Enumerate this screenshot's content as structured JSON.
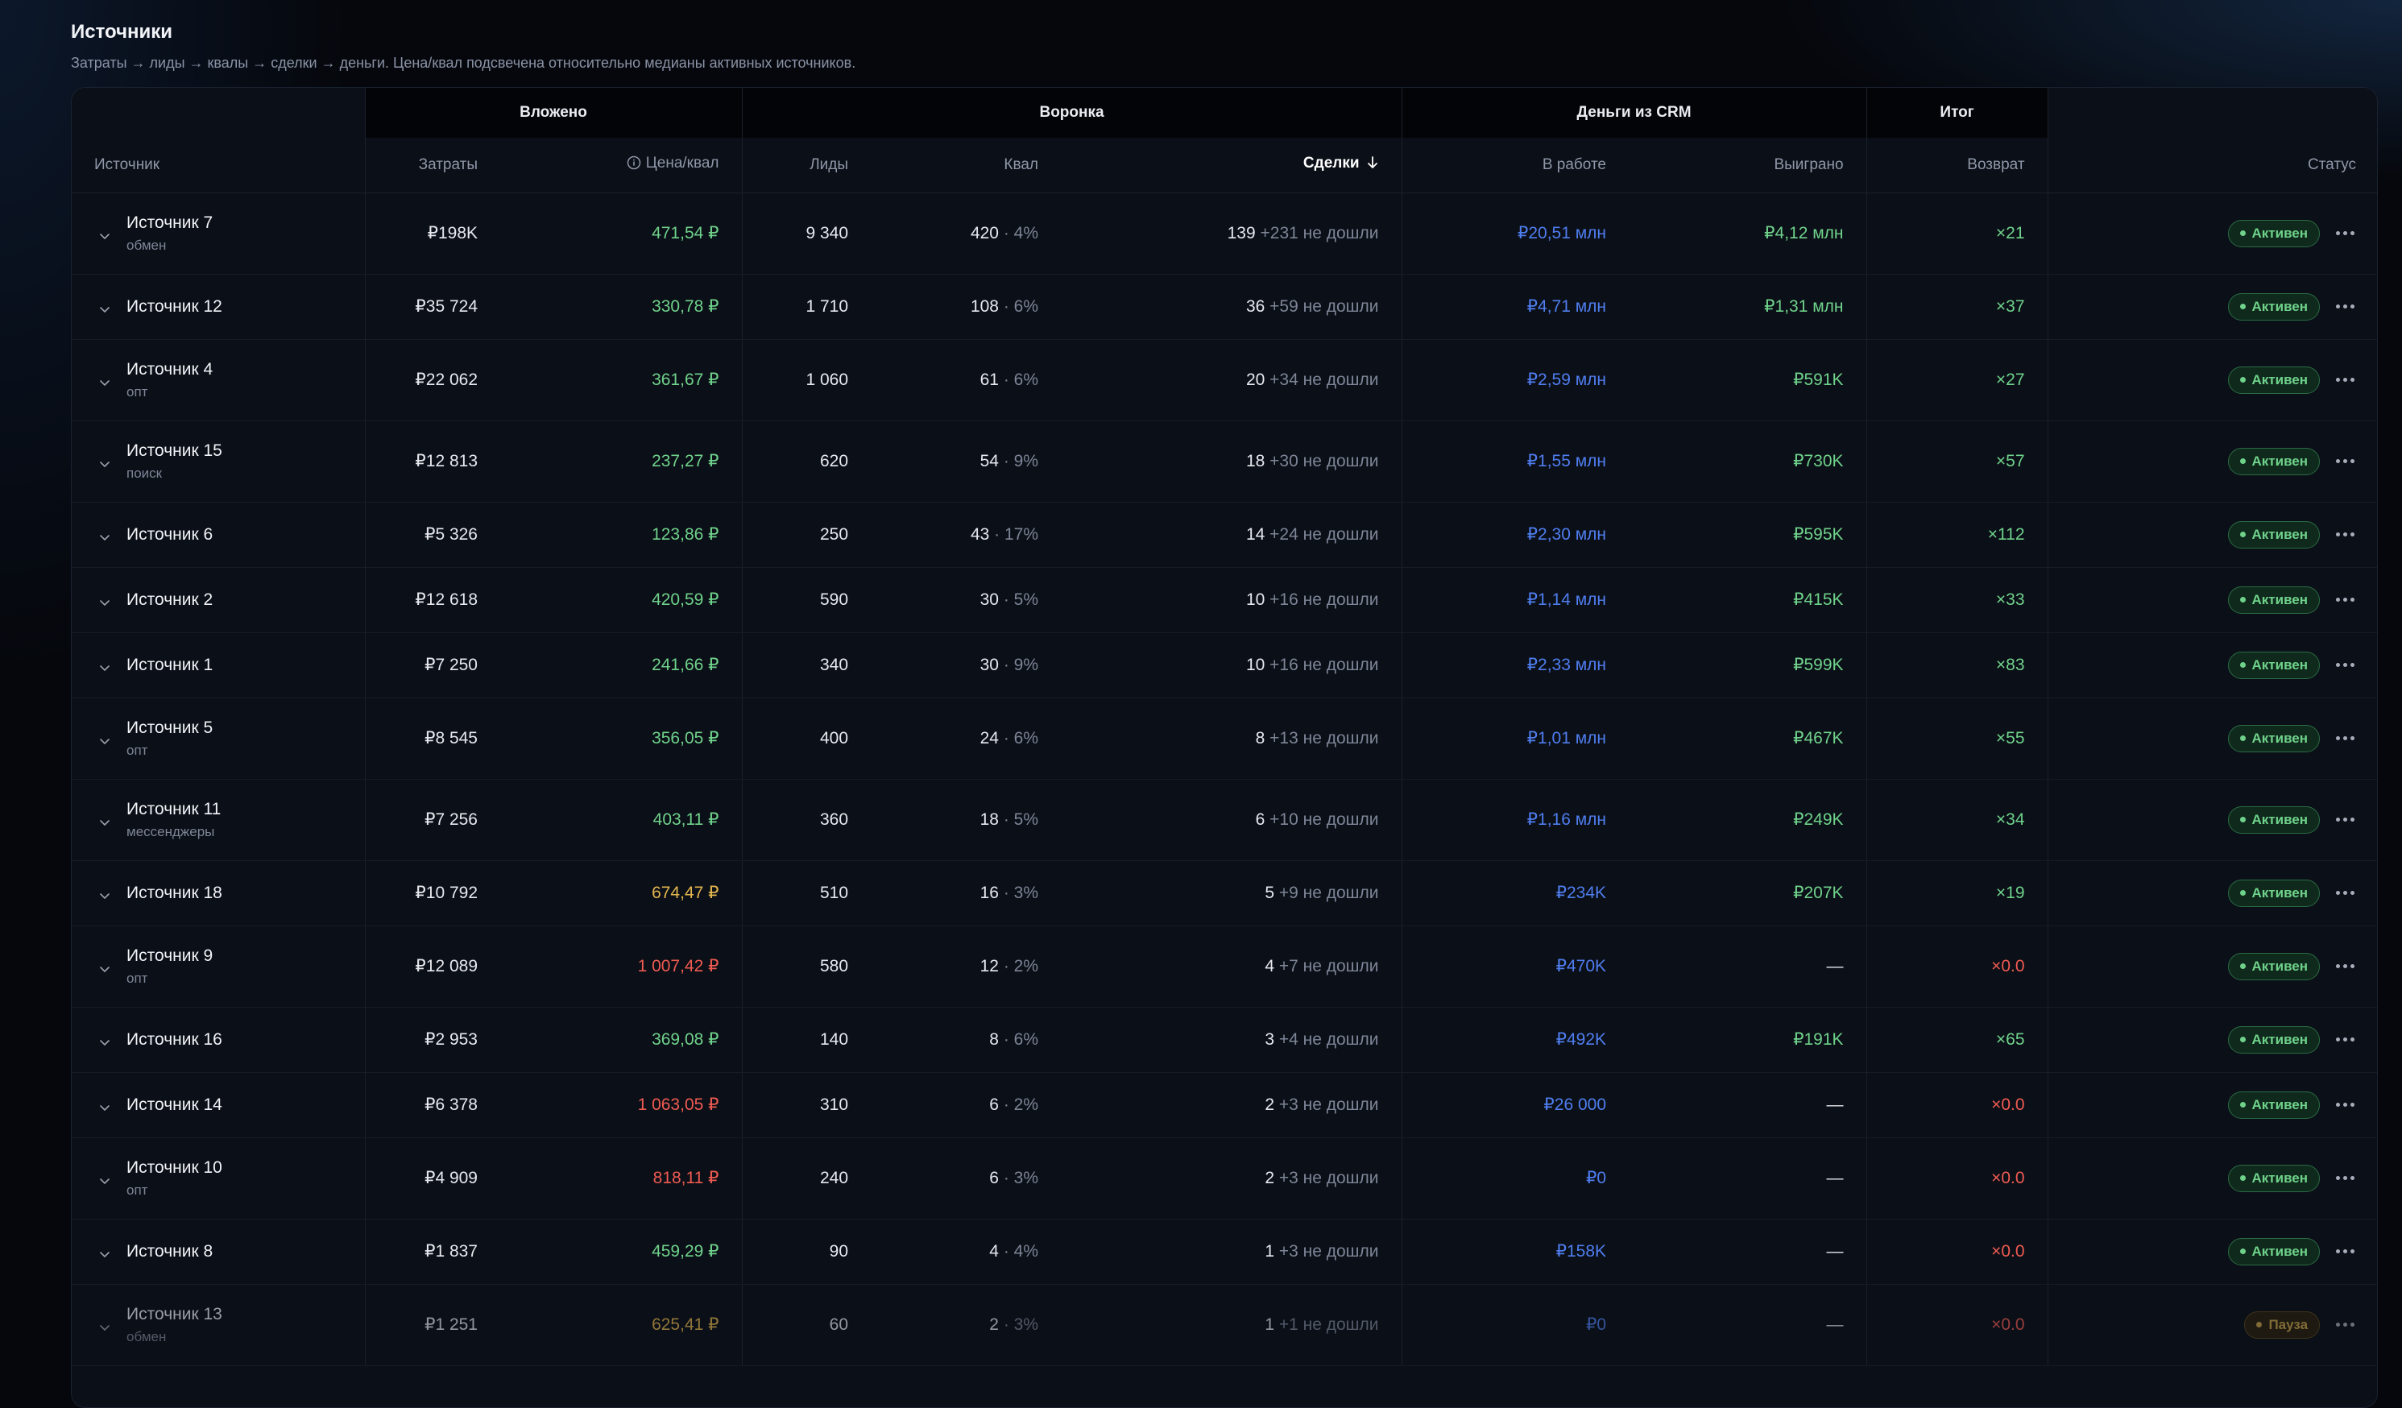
{
  "page": {
    "title": "Источники",
    "subtitle": "Затраты → лиды → квалы → сделки → деньги. Цена/квал подсвечена относительно медианы активных источников."
  },
  "colors": {
    "accent_blue": "#4f7ef0",
    "good_green": "#6fd28b",
    "warn_yellow": "#e2b54e",
    "bad_red": "#ef5b52"
  },
  "table": {
    "groups": {
      "invested": "Вложено",
      "funnel": "Воронка",
      "crm": "Деньги из CRM",
      "total": "Итог"
    },
    "columns": {
      "source": "Источник",
      "cost": "Затраты",
      "cpq": "Цена/квал",
      "leads": "Лиды",
      "qual": "Квал",
      "deals": "Сделки",
      "in_work": "В работе",
      "won": "Выиграно",
      "return": "Возврат",
      "status": "Статус"
    },
    "sort": {
      "column": "deals",
      "direction": "desc",
      "icon": "arrow-down-icon"
    },
    "rows": [
      {
        "name": "Источник 7",
        "sub": "обмен",
        "cost": "₽198K",
        "cpq": "471,54 ₽",
        "cpq_level": "green",
        "leads": "9 340",
        "qual": "420",
        "qual_pct": "4%",
        "deals": "139",
        "deals_lost": "+231 не дошли",
        "in_work": "₽20,51 млн",
        "won": "₽4,12 млн",
        "won_dash": false,
        "ret": "×21",
        "ret_level": "green",
        "status": "Активен",
        "status_type": "active"
      },
      {
        "name": "Источник 12",
        "sub": "",
        "cost": "₽35 724",
        "cpq": "330,78 ₽",
        "cpq_level": "green",
        "leads": "1 710",
        "qual": "108",
        "qual_pct": "6%",
        "deals": "36",
        "deals_lost": "+59 не дошли",
        "in_work": "₽4,71 млн",
        "won": "₽1,31 млн",
        "won_dash": false,
        "ret": "×37",
        "ret_level": "green",
        "status": "Активен",
        "status_type": "active"
      },
      {
        "name": "Источник 4",
        "sub": "опт",
        "cost": "₽22 062",
        "cpq": "361,67 ₽",
        "cpq_level": "green",
        "leads": "1 060",
        "qual": "61",
        "qual_pct": "6%",
        "deals": "20",
        "deals_lost": "+34 не дошли",
        "in_work": "₽2,59 млн",
        "won": "₽591K",
        "won_dash": false,
        "ret": "×27",
        "ret_level": "green",
        "status": "Активен",
        "status_type": "active"
      },
      {
        "name": "Источник 15",
        "sub": "поиск",
        "cost": "₽12 813",
        "cpq": "237,27 ₽",
        "cpq_level": "green",
        "leads": "620",
        "qual": "54",
        "qual_pct": "9%",
        "deals": "18",
        "deals_lost": "+30 не дошли",
        "in_work": "₽1,55 млн",
        "won": "₽730K",
        "won_dash": false,
        "ret": "×57",
        "ret_level": "green",
        "status": "Активен",
        "status_type": "active"
      },
      {
        "name": "Источник 6",
        "sub": "",
        "cost": "₽5 326",
        "cpq": "123,86 ₽",
        "cpq_level": "green",
        "leads": "250",
        "qual": "43",
        "qual_pct": "17%",
        "deals": "14",
        "deals_lost": "+24 не дошли",
        "in_work": "₽2,30 млн",
        "won": "₽595K",
        "won_dash": false,
        "ret": "×112",
        "ret_level": "green",
        "status": "Активен",
        "status_type": "active"
      },
      {
        "name": "Источник 2",
        "sub": "",
        "cost": "₽12 618",
        "cpq": "420,59 ₽",
        "cpq_level": "green",
        "leads": "590",
        "qual": "30",
        "qual_pct": "5%",
        "deals": "10",
        "deals_lost": "+16 не дошли",
        "in_work": "₽1,14 млн",
        "won": "₽415K",
        "won_dash": false,
        "ret": "×33",
        "ret_level": "green",
        "status": "Активен",
        "status_type": "active"
      },
      {
        "name": "Источник 1",
        "sub": "",
        "cost": "₽7 250",
        "cpq": "241,66 ₽",
        "cpq_level": "green",
        "leads": "340",
        "qual": "30",
        "qual_pct": "9%",
        "deals": "10",
        "deals_lost": "+16 не дошли",
        "in_work": "₽2,33 млн",
        "won": "₽599K",
        "won_dash": false,
        "ret": "×83",
        "ret_level": "green",
        "status": "Активен",
        "status_type": "active"
      },
      {
        "name": "Источник 5",
        "sub": "опт",
        "cost": "₽8 545",
        "cpq": "356,05 ₽",
        "cpq_level": "green",
        "leads": "400",
        "qual": "24",
        "qual_pct": "6%",
        "deals": "8",
        "deals_lost": "+13 не дошли",
        "in_work": "₽1,01 млн",
        "won": "₽467K",
        "won_dash": false,
        "ret": "×55",
        "ret_level": "green",
        "status": "Активен",
        "status_type": "active"
      },
      {
        "name": "Источник 11",
        "sub": "мессенджеры",
        "cost": "₽7 256",
        "cpq": "403,11 ₽",
        "cpq_level": "green",
        "leads": "360",
        "qual": "18",
        "qual_pct": "5%",
        "deals": "6",
        "deals_lost": "+10 не дошли",
        "in_work": "₽1,16 млн",
        "won": "₽249K",
        "won_dash": false,
        "ret": "×34",
        "ret_level": "green",
        "status": "Активен",
        "status_type": "active"
      },
      {
        "name": "Источник 18",
        "sub": "",
        "cost": "₽10 792",
        "cpq": "674,47 ₽",
        "cpq_level": "yellow",
        "leads": "510",
        "qual": "16",
        "qual_pct": "3%",
        "deals": "5",
        "deals_lost": "+9 не дошли",
        "in_work": "₽234K",
        "won": "₽207K",
        "won_dash": false,
        "ret": "×19",
        "ret_level": "green",
        "status": "Активен",
        "status_type": "active"
      },
      {
        "name": "Источник 9",
        "sub": "опт",
        "cost": "₽12 089",
        "cpq": "1 007,42 ₽",
        "cpq_level": "red",
        "leads": "580",
        "qual": "12",
        "qual_pct": "2%",
        "deals": "4",
        "deals_lost": "+7 не дошли",
        "in_work": "₽470K",
        "won": "—",
        "won_dash": true,
        "ret": "×0.0",
        "ret_level": "red",
        "status": "Активен",
        "status_type": "active"
      },
      {
        "name": "Источник 16",
        "sub": "",
        "cost": "₽2 953",
        "cpq": "369,08 ₽",
        "cpq_level": "green",
        "leads": "140",
        "qual": "8",
        "qual_pct": "6%",
        "deals": "3",
        "deals_lost": "+4 не дошли",
        "in_work": "₽492K",
        "won": "₽191K",
        "won_dash": false,
        "ret": "×65",
        "ret_level": "green",
        "status": "Активен",
        "status_type": "active"
      },
      {
        "name": "Источник 14",
        "sub": "",
        "cost": "₽6 378",
        "cpq": "1 063,05 ₽",
        "cpq_level": "red",
        "leads": "310",
        "qual": "6",
        "qual_pct": "2%",
        "deals": "2",
        "deals_lost": "+3 не дошли",
        "in_work": "₽26 000",
        "won": "—",
        "won_dash": true,
        "ret": "×0.0",
        "ret_level": "red",
        "status": "Активен",
        "status_type": "active"
      },
      {
        "name": "Источник 10",
        "sub": "опт",
        "cost": "₽4 909",
        "cpq": "818,11 ₽",
        "cpq_level": "red",
        "leads": "240",
        "qual": "6",
        "qual_pct": "3%",
        "deals": "2",
        "deals_lost": "+3 не дошли",
        "in_work": "₽0",
        "won": "—",
        "won_dash": true,
        "ret": "×0.0",
        "ret_level": "red",
        "status": "Активен",
        "status_type": "active"
      },
      {
        "name": "Источник 8",
        "sub": "",
        "cost": "₽1 837",
        "cpq": "459,29 ₽",
        "cpq_level": "green",
        "leads": "90",
        "qual": "4",
        "qual_pct": "4%",
        "deals": "1",
        "deals_lost": "+3 не дошли",
        "in_work": "₽158K",
        "won": "—",
        "won_dash": true,
        "ret": "×0.0",
        "ret_level": "red",
        "status": "Активен",
        "status_type": "active"
      },
      {
        "name": "Источник 13",
        "sub": "обмен",
        "cost": "₽1 251",
        "cpq": "625,41 ₽",
        "cpq_level": "yellow",
        "leads": "60",
        "qual": "2",
        "qual_pct": "3%",
        "deals": "1",
        "deals_lost": "+1 не дошли",
        "in_work": "₽0",
        "won": "—",
        "won_dash": true,
        "ret": "×0.0",
        "ret_level": "red",
        "status": "Пауза",
        "status_type": "pause"
      }
    ]
  }
}
